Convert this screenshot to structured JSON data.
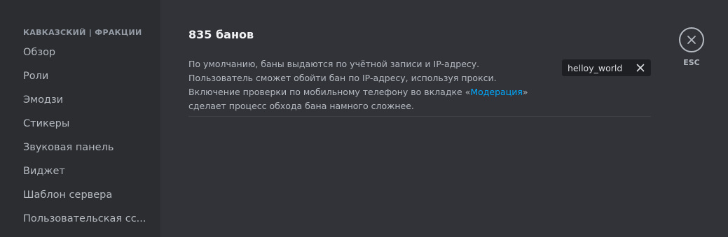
{
  "sidebar": {
    "header": "КАВКАЗСКИЙ | ФРАКЦИИ",
    "items": [
      {
        "label": "Обзор"
      },
      {
        "label": "Роли"
      },
      {
        "label": "Эмодзи"
      },
      {
        "label": "Стикеры"
      },
      {
        "label": "Звуковая панель"
      },
      {
        "label": "Виджет"
      },
      {
        "label": "Шаблон сервера"
      },
      {
        "label": "Пользовательская сс..."
      }
    ]
  },
  "main": {
    "title": "835 банов",
    "description": {
      "before_link": "По умолчанию, баны выдаются по учётной записи и IP-адресу. Пользователь сможет обойти бан по IP-адресу, используя прокси. Включение проверки по мобильному телефону во вкладке «",
      "link": "Модерация",
      "after_link": "» сделает процесс обхода бана намного сложнее."
    },
    "search": {
      "value": "helloy_world",
      "clear_icon": "close-icon"
    }
  },
  "close": {
    "icon": "close-icon",
    "label": "ESC"
  },
  "colors": {
    "sidebar_bg": "#2b2d31",
    "main_bg": "#313338",
    "link": "#00a8fc",
    "title": "#f2f3f5",
    "muted": "#b5bac1"
  }
}
